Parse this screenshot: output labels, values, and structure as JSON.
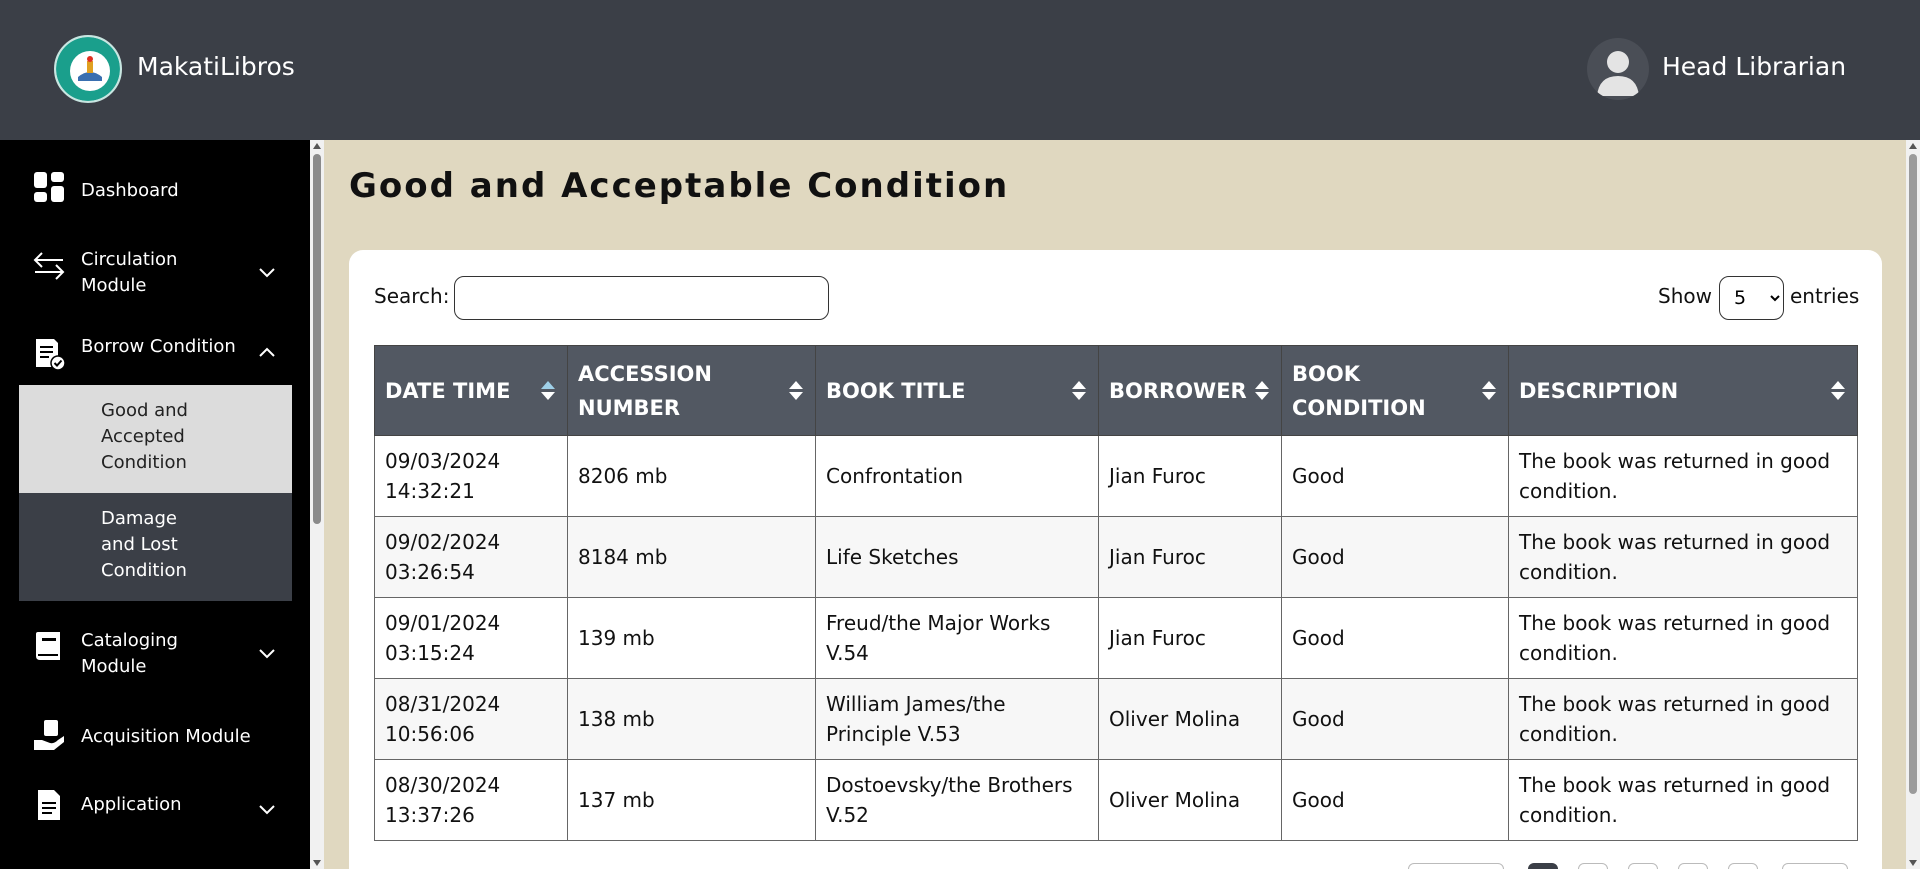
{
  "header": {
    "brand": "MakatiLibros",
    "user": "Head Librarian",
    "logo_icon": "library-seal-logo",
    "avatar_icon": "user-avatar-icon"
  },
  "sidebar": {
    "items": [
      {
        "label": "Dashboard",
        "icon": "dashboard-icon"
      },
      {
        "label": "Circulation\nModule",
        "icon": "circulation-icon"
      },
      {
        "label": "Borrow Condition",
        "icon": "borrow-condition-icon"
      },
      {
        "label": "Cataloging\nModule",
        "icon": "catalog-book-icon"
      },
      {
        "label": "Acquisition Module",
        "icon": "acquisition-icon"
      },
      {
        "label": "Application",
        "icon": "application-doc-icon"
      }
    ],
    "submenu": [
      {
        "label": "Good and\nAccepted\nCondition",
        "active": true
      },
      {
        "label": "Damage\nand Lost\nCondition",
        "active": false
      }
    ]
  },
  "main": {
    "title": "Good and Acceptable Condition",
    "search_label": "Search:",
    "search_value": "",
    "show_label": "Show",
    "entries_value": "5",
    "entries_label": "entries"
  },
  "table": {
    "columns": [
      "DATE TIME",
      "ACCESSION\nNUMBER",
      "BOOK TITLE",
      "BORROWER",
      "BOOK\nCONDITION",
      "DESCRIPTION"
    ],
    "rows": [
      [
        "09/03/2024\n14:32:21",
        "8206 mb",
        "Confrontation",
        "Jian Furoc",
        "Good",
        "The book was returned in good\ncondition."
      ],
      [
        "09/02/2024\n03:26:54",
        "8184 mb",
        "Life Sketches",
        "Jian Furoc",
        "Good",
        "The book was returned in good\ncondition."
      ],
      [
        "09/01/2024\n03:15:24",
        "139 mb",
        "Freud/the Major Works\nV.54",
        "Jian Furoc",
        "Good",
        "The book was returned in good\ncondition."
      ],
      [
        "08/31/2024\n10:56:06",
        "138 mb",
        "William James/the\nPrinciple V.53",
        "Oliver Molina",
        "Good",
        "The book was returned in good\ncondition."
      ],
      [
        "08/30/2024\n13:37:26",
        "137 mb",
        "Dostoevsky/the Brothers\nV.52",
        "Oliver Molina",
        "Good",
        "The book was returned in good\ncondition."
      ]
    ]
  },
  "colors": {
    "header_bg": "#3b3f47",
    "sidebar_bg": "#000000",
    "page_bg": "#e0d8c0",
    "table_header_bg": "#525862",
    "active_sub_bg": "#dcdcdc"
  }
}
